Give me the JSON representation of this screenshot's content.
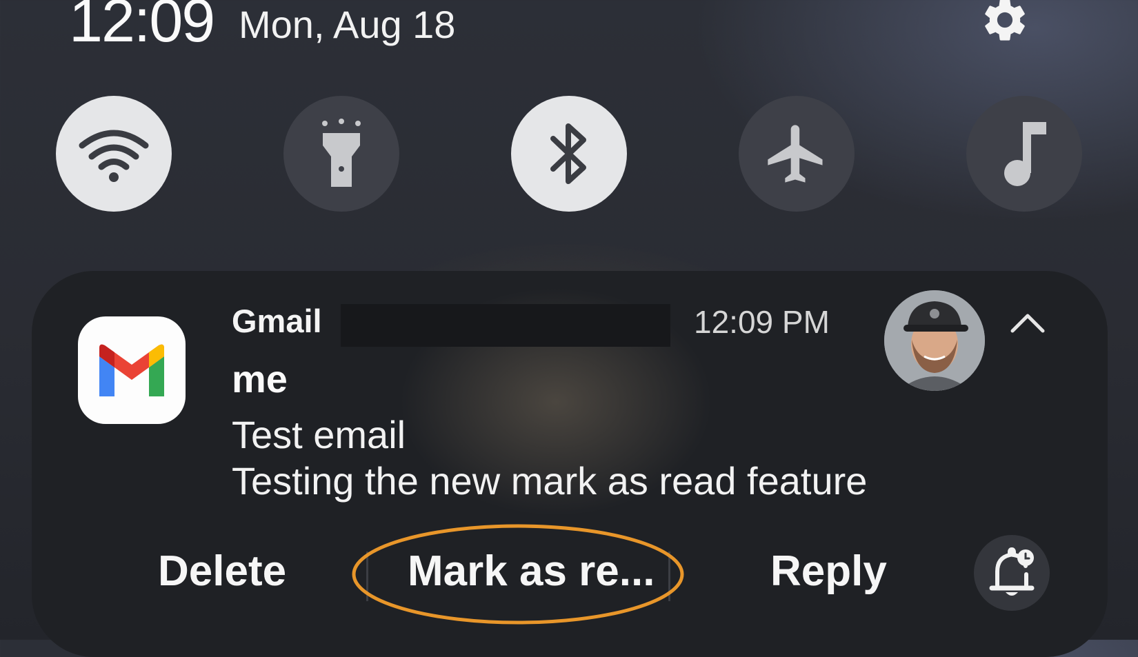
{
  "status": {
    "time": "12:09",
    "date": "Mon, Aug 18"
  },
  "quick_settings": {
    "tiles": [
      {
        "name": "Wi-Fi",
        "icon": "wifi-icon",
        "state": "on"
      },
      {
        "name": "Flashlight",
        "icon": "flashlight-icon",
        "state": "off"
      },
      {
        "name": "Bluetooth",
        "icon": "bluetooth-icon",
        "state": "on"
      },
      {
        "name": "Airplane mode",
        "icon": "airplane-icon",
        "state": "off"
      },
      {
        "name": "Sound",
        "icon": "music-note-icon",
        "state": "off"
      }
    ]
  },
  "notification": {
    "app_name": "Gmail",
    "time": "12:09 PM",
    "sender": "me",
    "subject": "Test email",
    "body": "Testing the new mark as read feature",
    "actions": {
      "delete": "Delete",
      "mark_as_read": "Mark as re...",
      "reply": "Reply"
    }
  },
  "colors": {
    "highlight_ring": "#e8962a",
    "tile_on": "#e5e6e8",
    "tile_off": "#3e4048",
    "card_bg": "#1f2125"
  }
}
